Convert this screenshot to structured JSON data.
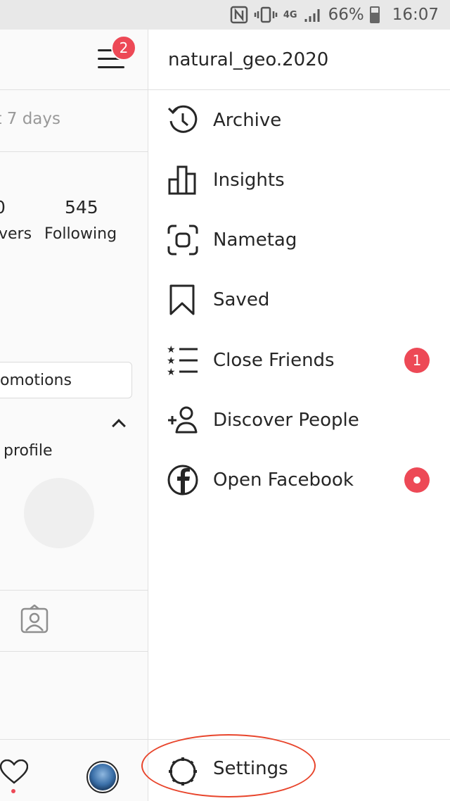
{
  "status_bar": {
    "nfc_icon": "nfc-icon",
    "vibrate_icon": "vibrate-icon",
    "network": "4G",
    "signal_icon": "signal-icon",
    "battery_percent": "66%",
    "time": "16:07"
  },
  "background_profile": {
    "notification_count": "2",
    "days_text": "t 7 days",
    "followers_count": "0",
    "followers_label": "vers",
    "following_count": "545",
    "following_label": "Following",
    "promotions_label": "omotions",
    "profile_text": "profile"
  },
  "drawer": {
    "username": "natural_geo.2020",
    "items": [
      {
        "label": "Archive",
        "icon": "archive-icon"
      },
      {
        "label": "Insights",
        "icon": "insights-icon"
      },
      {
        "label": "Nametag",
        "icon": "nametag-icon"
      },
      {
        "label": "Saved",
        "icon": "bookmark-icon"
      },
      {
        "label": "Close Friends",
        "icon": "close-friends-icon",
        "badge": "1"
      },
      {
        "label": "Discover People",
        "icon": "add-person-icon"
      },
      {
        "label": "Open Facebook",
        "icon": "facebook-icon",
        "dot": true
      }
    ],
    "settings_label": "Settings"
  },
  "colors": {
    "accent_red": "#ed4956",
    "annotation_oval": "#e8452c",
    "text": "#262626"
  }
}
